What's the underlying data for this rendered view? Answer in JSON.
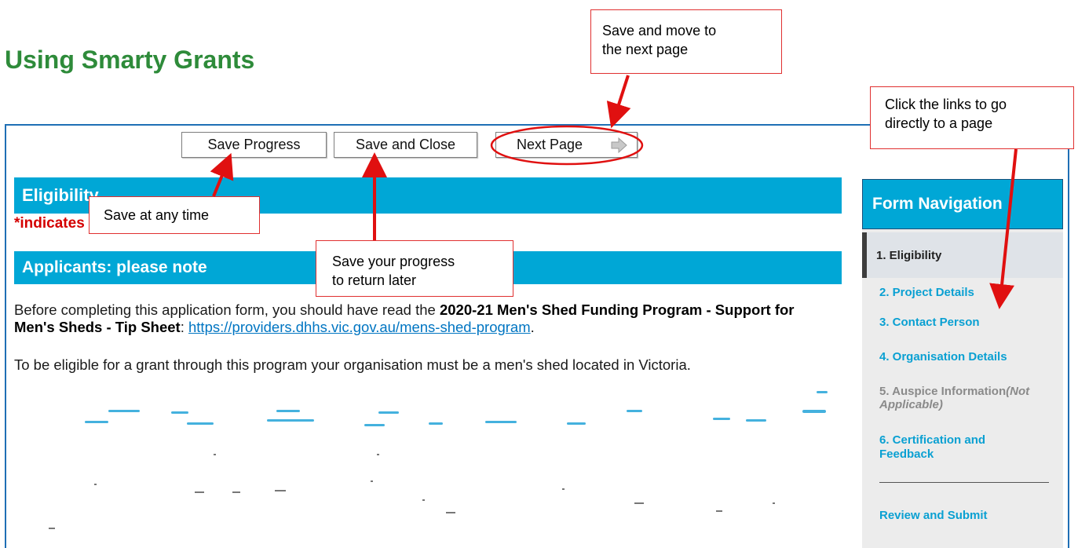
{
  "page": {
    "title": "Using Smarty Grants"
  },
  "toolbar": {
    "save_progress_label": "Save Progress",
    "save_close_label": "Save and Close",
    "next_page_label": "Next Page",
    "next_icon": "arrow-right-icon"
  },
  "form": {
    "section_title": "Eligibility",
    "required_note": "*indicates",
    "note_heading": "Applicants: please note",
    "para1_prefix": "Before completing this application form, you should have read the ",
    "para1_bold": "2020-21 Men's Shed Funding Program - Support for Men's Sheds - Tip Sheet",
    "para1_sep": ": ",
    "para1_link": "https://providers.dhhs.vic.gov.au/mens-shed-program",
    "para1_end": ".",
    "para2": "To be eligible for a grant through this program your organisation must be a men's shed located in Victoria."
  },
  "nav": {
    "heading": "Form Navigation",
    "items": [
      {
        "label": "1. Eligibility",
        "state": "current"
      },
      {
        "label": "2. Project Details",
        "state": "link"
      },
      {
        "label": "3. Contact Person",
        "state": "link"
      },
      {
        "label": "4. Organisation Details",
        "state": "link"
      },
      {
        "label": "5. Auspice Information",
        "suffix": "(Not Applicable)",
        "state": "disabled"
      },
      {
        "label": "6. Certification and Feedback",
        "state": "link"
      }
    ],
    "review_label": "Review and Submit"
  },
  "callouts": {
    "save_any_time": "Save at any time",
    "save_return_line1": "Save your progress",
    "save_return_line2": "to return later",
    "next_line1": "Save and move to",
    "next_line2": "the next page",
    "links_line1": "Click the links to go",
    "links_line2": "directly to a page"
  },
  "colors": {
    "title_green": "#2e8b3a",
    "bar_blue": "#00a7d6",
    "callout_red": "#e03030",
    "link_blue": "#0075c2",
    "required_red": "#d40000"
  }
}
